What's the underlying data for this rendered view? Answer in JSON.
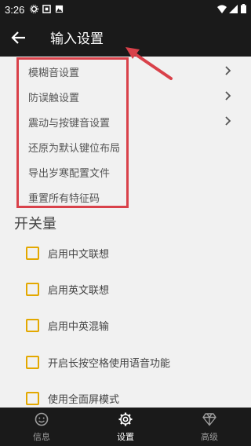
{
  "status_bar": {
    "time": "3:26",
    "icons": [
      "gear-icon",
      "box-icon",
      "image-icon"
    ],
    "right_icons": [
      "wifi-icon",
      "signal-icon",
      "battery-icon"
    ]
  },
  "app_bar": {
    "title": "输入设置",
    "back_icon": "arrow-left-icon"
  },
  "menu": {
    "items": [
      {
        "label": "模糊音设置",
        "has_chevron": true
      },
      {
        "label": "防误触设置",
        "has_chevron": true
      },
      {
        "label": "震动与按键音设置",
        "has_chevron": true
      },
      {
        "label": "还原为默认键位布局",
        "has_chevron": false
      },
      {
        "label": "导出岁寒配置文件",
        "has_chevron": false
      },
      {
        "label": "重置所有特征码",
        "has_chevron": false
      }
    ]
  },
  "toggles": {
    "section_title": "开关量",
    "items": [
      {
        "label": "启用中文联想",
        "checked": false
      },
      {
        "label": "启用英文联想",
        "checked": false
      },
      {
        "label": "启用中英混输",
        "checked": false
      },
      {
        "label": "开启长按空格使用语音功能",
        "checked": false
      },
      {
        "label": "使用全面屏模式",
        "checked": false
      }
    ]
  },
  "tabs": [
    {
      "label": "信息",
      "icon": "smile-icon",
      "active": false
    },
    {
      "label": "设置",
      "icon": "gear-icon",
      "active": true
    },
    {
      "label": "高级",
      "icon": "diamond-icon",
      "active": false
    }
  ],
  "colors": {
    "bar": "#1a1a1a",
    "background": "#f1f1f1",
    "highlight": "#d9414a",
    "checkbox": "#e3a800"
  }
}
